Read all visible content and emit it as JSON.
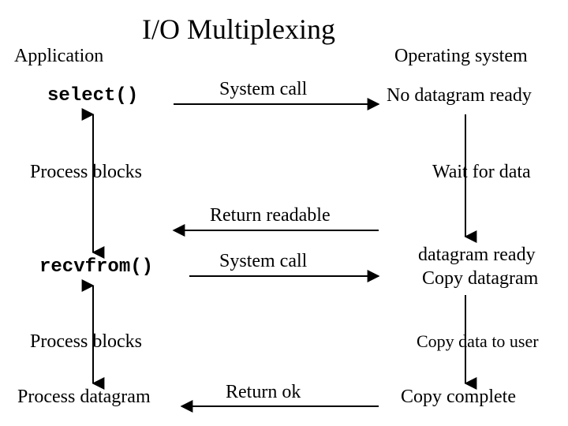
{
  "title": "I/O Multiplexing",
  "headers": {
    "application": "Application",
    "os": "Operating system"
  },
  "app": {
    "select": "select()",
    "process_blocks_1": "Process blocks",
    "recvfrom": "recvfrom()",
    "process_blocks_2": "Process blocks",
    "process_datagram": "Process datagram"
  },
  "arrows": {
    "system_call_1": "System call",
    "return_readable": "Return readable",
    "system_call_2": "System call",
    "return_ok": "Return ok"
  },
  "os": {
    "no_datagram_ready": "No datagram ready",
    "wait_for_data": "Wait for data",
    "datagram_ready": "datagram ready",
    "copy_datagram": "Copy datagram",
    "copy_data_to_user": "Copy data to user",
    "copy_complete": "Copy complete"
  }
}
